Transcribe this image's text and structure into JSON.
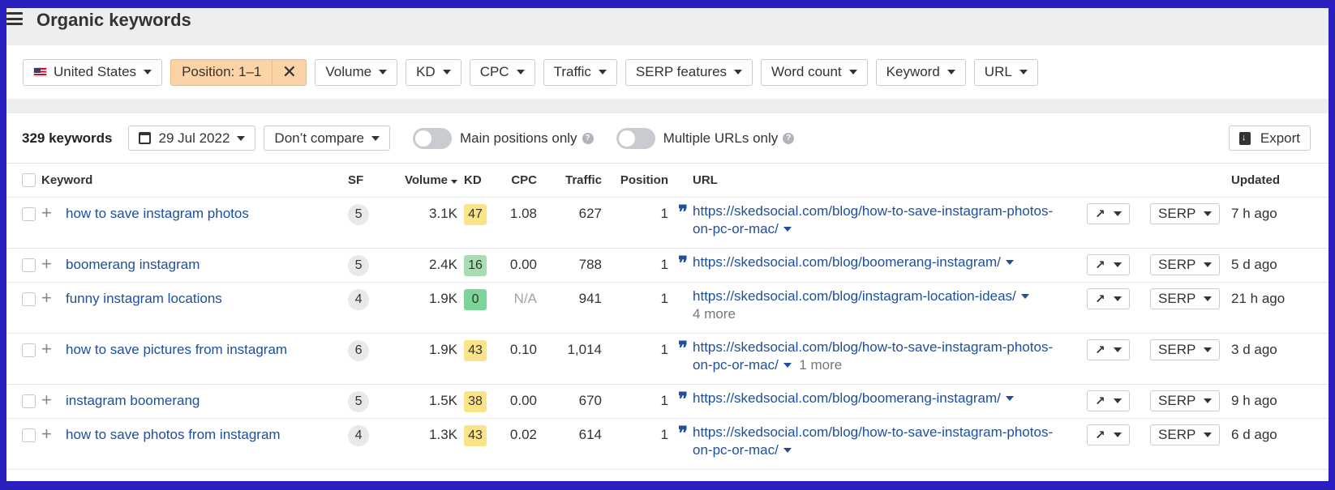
{
  "header": {
    "title": "Organic keywords"
  },
  "filters": {
    "country": "United States",
    "position": "Position: 1–1",
    "volume": "Volume",
    "kd": "KD",
    "cpc": "CPC",
    "traffic": "Traffic",
    "serp_features": "SERP features",
    "word_count": "Word count",
    "keyword": "Keyword",
    "url": "URL"
  },
  "toolbar": {
    "count": "329 keywords",
    "date": "29 Jul 2022",
    "compare": "Don’t compare",
    "main_positions": "Main positions only",
    "multiple_urls": "Multiple URLs only",
    "export": "Export"
  },
  "columns": {
    "keyword": "Keyword",
    "sf": "SF",
    "volume": "Volume",
    "kd": "KD",
    "cpc": "CPC",
    "traffic": "Traffic",
    "position": "Position",
    "url": "URL",
    "updated": "Updated"
  },
  "colors": {
    "kd_yellow": "#fbe38a",
    "kd_green_light": "#a8ddb4",
    "kd_green": "#7ed398",
    "link": "#1d4f9c"
  },
  "rows": [
    {
      "keyword": "how to save instagram photos",
      "sf": "5",
      "volume": "3.1K",
      "kd": "47",
      "kd_color": "#fbe38a",
      "cpc": "1.08",
      "traffic": "627",
      "position": "1",
      "url1": "https://skedsocial.com/blog/how-to-save-instagram-photos-",
      "url2": "on-pc-or-mac/",
      "more": "",
      "serp": "SERP",
      "updated": "7 h ago",
      "quote": true
    },
    {
      "keyword": "boomerang instagram",
      "sf": "5",
      "volume": "2.4K",
      "kd": "16",
      "kd_color": "#a8ddb4",
      "cpc": "0.00",
      "traffic": "788",
      "position": "1",
      "url1": "https://skedsocial.com/blog/boomerang-instagram/",
      "url2": "",
      "more": "",
      "serp": "SERP",
      "updated": "5 d ago",
      "quote": true
    },
    {
      "keyword": "funny instagram locations",
      "sf": "4",
      "volume": "1.9K",
      "kd": "0",
      "kd_color": "#7ed398",
      "cpc": "N/A",
      "traffic": "941",
      "position": "1",
      "url1": "https://skedsocial.com/blog/instagram-location-ideas/",
      "url2": "",
      "more": "4 more",
      "serp": "SERP",
      "updated": "21 h ago",
      "quote": false
    },
    {
      "keyword": "how to save pictures from instagram",
      "sf": "6",
      "volume": "1.9K",
      "kd": "43",
      "kd_color": "#fbe38a",
      "cpc": "0.10",
      "traffic": "1,014",
      "position": "1",
      "url1": "https://skedsocial.com/blog/how-to-save-instagram-photos-",
      "url2": "on-pc-or-mac/",
      "more": "1 more",
      "serp": "SERP",
      "updated": "3 d ago",
      "quote": true
    },
    {
      "keyword": "instagram boomerang",
      "sf": "5",
      "volume": "1.5K",
      "kd": "38",
      "kd_color": "#fbe38a",
      "cpc": "0.00",
      "traffic": "670",
      "position": "1",
      "url1": "https://skedsocial.com/blog/boomerang-instagram/",
      "url2": "",
      "more": "",
      "serp": "SERP",
      "updated": "9 h ago",
      "quote": true
    },
    {
      "keyword": "how to save photos from instagram",
      "sf": "4",
      "volume": "1.3K",
      "kd": "43",
      "kd_color": "#fbe38a",
      "cpc": "0.02",
      "traffic": "614",
      "position": "1",
      "url1": "https://skedsocial.com/blog/how-to-save-instagram-photos-",
      "url2": "on-pc-or-mac/",
      "more": "",
      "serp": "SERP",
      "updated": "6 d ago",
      "quote": true
    }
  ]
}
